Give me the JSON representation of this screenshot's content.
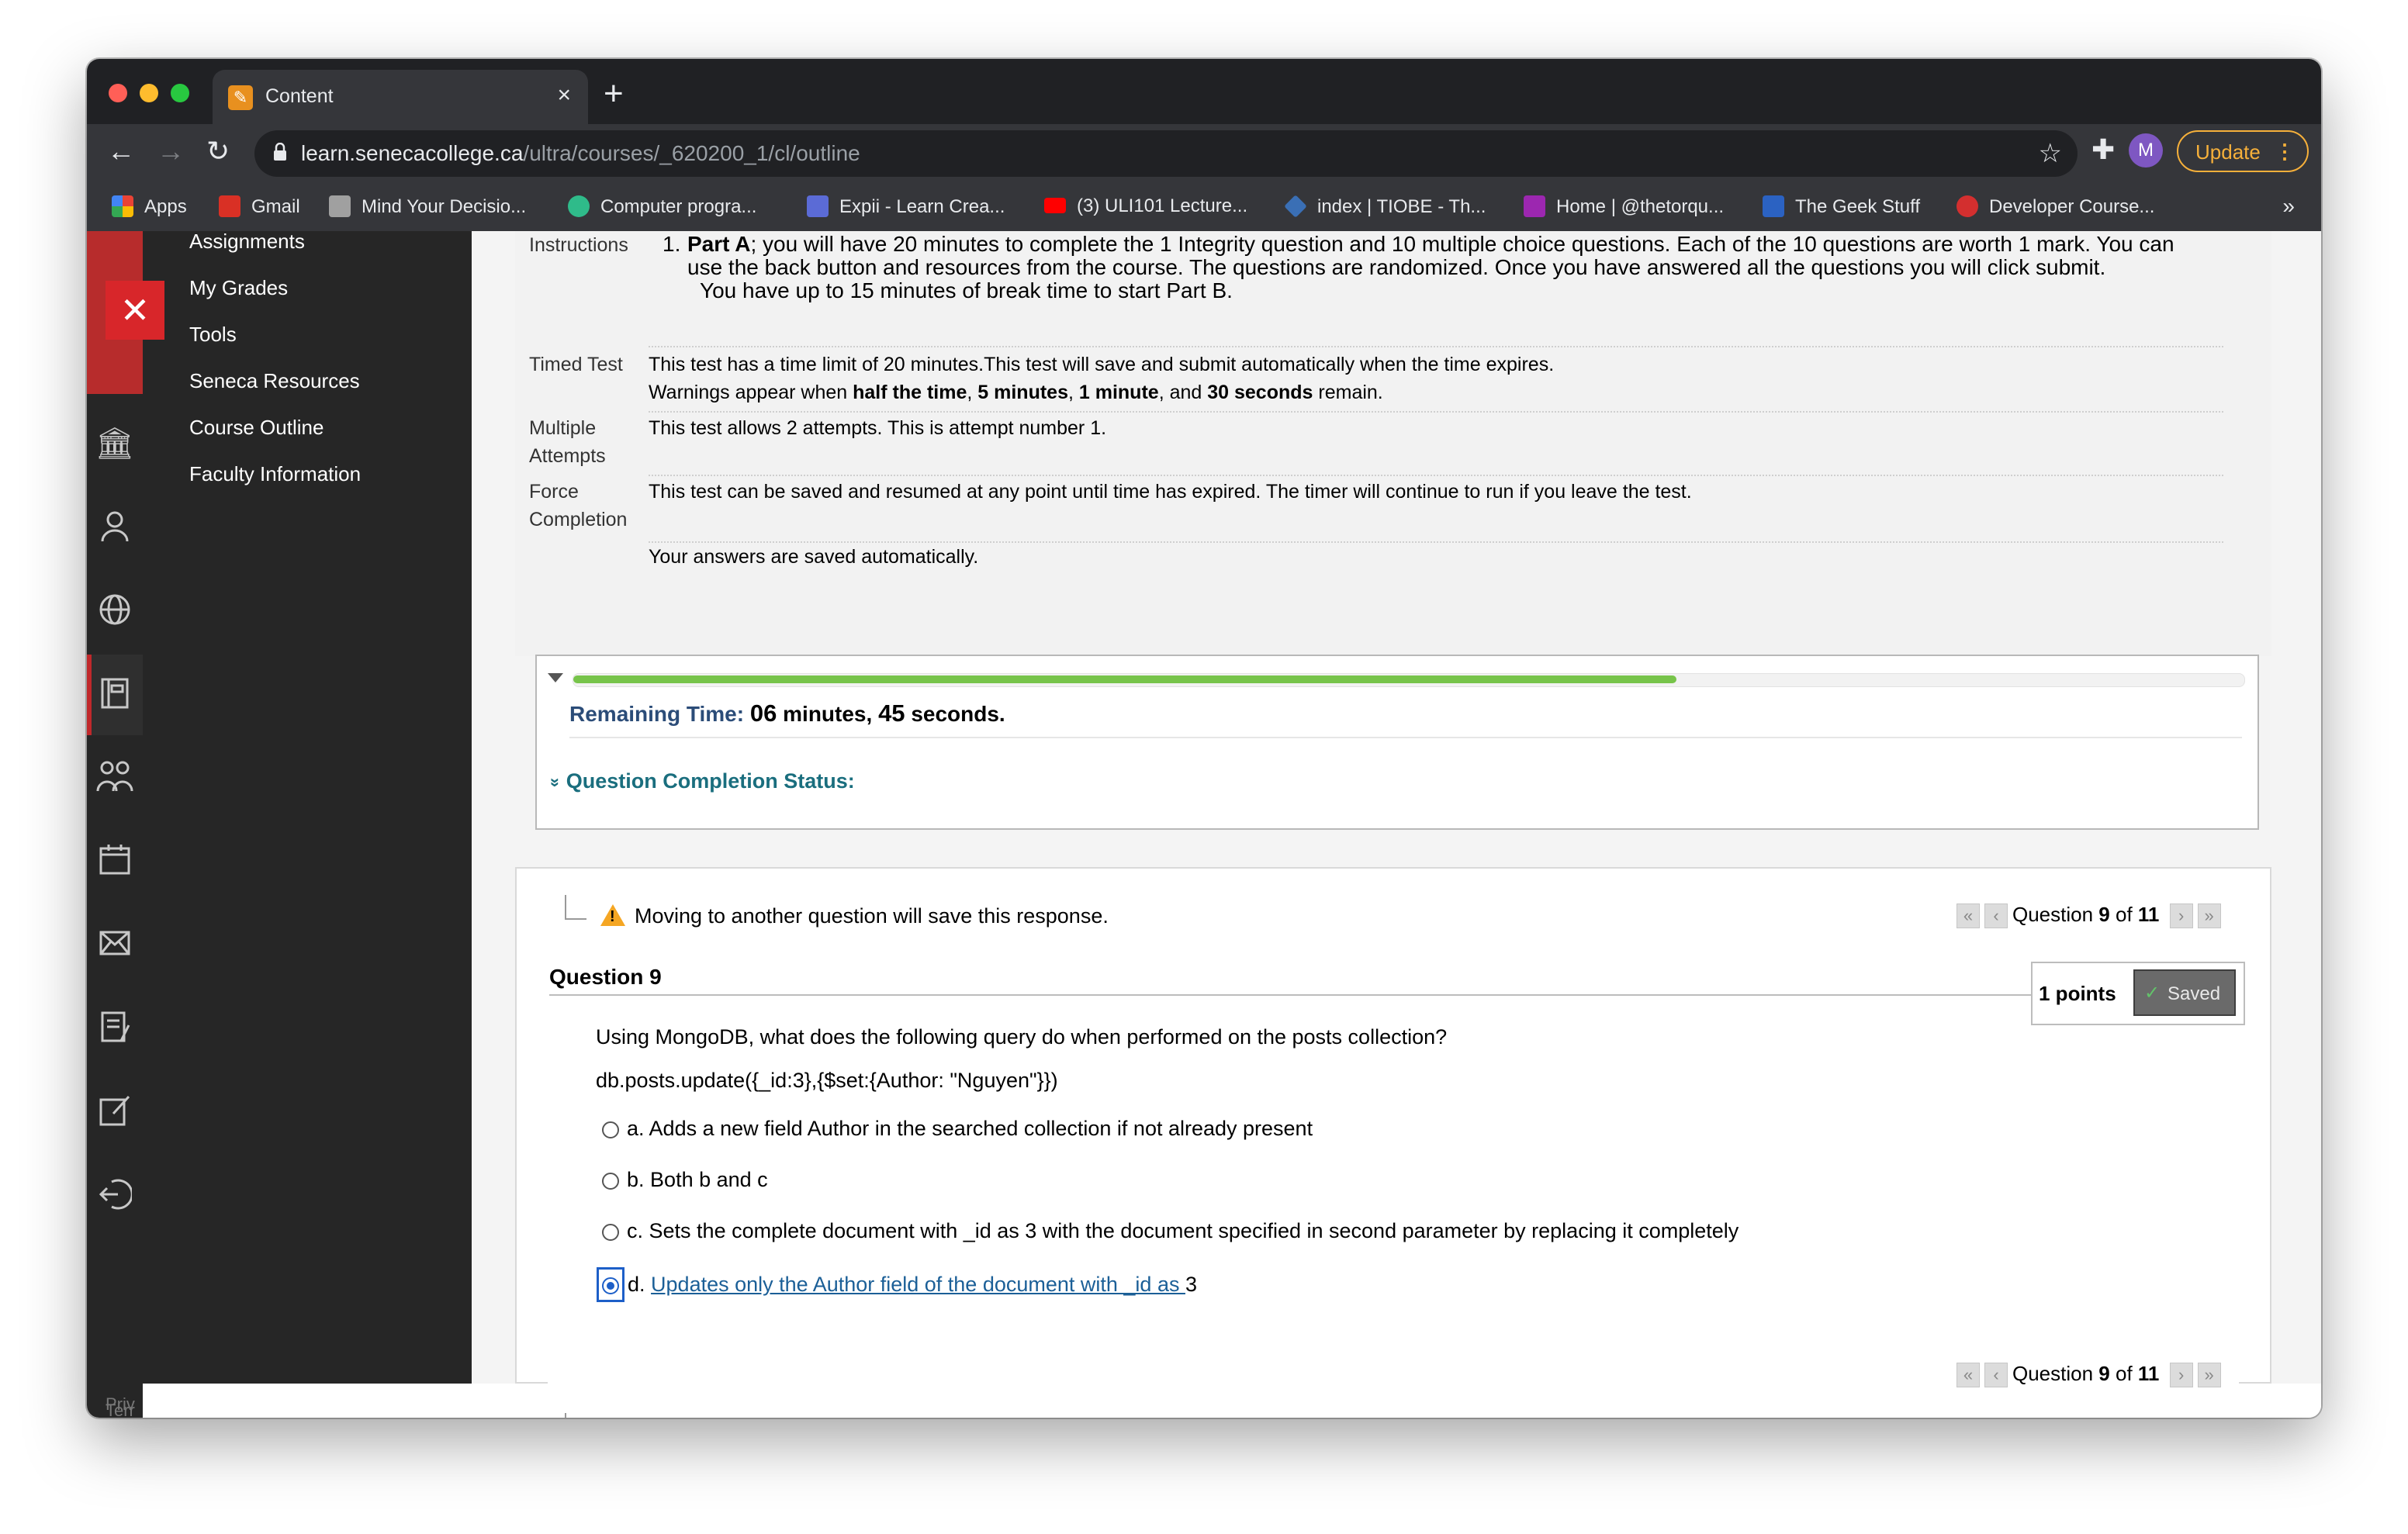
{
  "browser": {
    "tab_title": "Content",
    "tab_close": "×",
    "new_tab": "+",
    "url_host": "learn.senecacollege.ca",
    "url_path": "/ultra/courses/_620200_1/cl/outline",
    "profile_initial": "M",
    "update_label": "Update",
    "update_menu": "⋮",
    "bookmarks_more": "»",
    "bookmarks": [
      {
        "label": "Apps",
        "color": "#ea4335"
      },
      {
        "label": "Gmail",
        "color": "#d93025"
      },
      {
        "label": "Mind Your Decisio...",
        "color": "#a0a0a0"
      },
      {
        "label": "Computer progra...",
        "color": "#2fbb8a"
      },
      {
        "label": "Expii - Learn Crea...",
        "color": "#5b6bd6"
      },
      {
        "label": "(3) ULI101 Lecture...",
        "color": "#ff0000"
      },
      {
        "label": "index | TIOBE - Th...",
        "color": "#3a6fb5"
      },
      {
        "label": "Home | @thetorqu...",
        "color": "#9c27b0"
      },
      {
        "label": "The Geek Stuff",
        "color": "#2b62c2"
      },
      {
        "label": "Developer Course...",
        "color": "#d32f2f"
      }
    ]
  },
  "sidebar": {
    "close_glyph": "✕",
    "items": [
      "Assignments",
      "My Grades",
      "Tools",
      "Seneca Resources",
      "Course Outline",
      "Faculty Information"
    ],
    "footer_top": "Priv",
    "footer_bottom": "Terr"
  },
  "test_info": {
    "instructions_label": "Instructions",
    "instructions_num": "1.",
    "part_a": "Part A",
    "instructions_text": "; you will have 20 minutes to complete the 1 Integrity question and 10 multiple choice questions. Each of the 10 questions are worth 1 mark. You can use the back button and resources from the course.  The questions are randomized.  Once you have answered all the questions you will click submit.",
    "instructions_break": "You have up to 15 minutes of break time to start Part B.",
    "timed_label": "Timed Test",
    "timed_text": "This test has a time limit of 20 minutes.This test will save and submit automatically when the time expires.",
    "warn_prefix": "Warnings appear when ",
    "warn_1": "half the time",
    "warn_sep1": ", ",
    "warn_2": "5 minutes",
    "warn_sep2": ", ",
    "warn_3": "1 minute",
    "warn_sep3": ", and ",
    "warn_4": "30 seconds",
    "warn_suffix": " remain.",
    "multiple_label_1": "Multiple",
    "multiple_label_2": "Attempts",
    "multiple_text": "This test allows 2 attempts. This is attempt number 1.",
    "force_label_1": "Force",
    "force_label_2": "Completion",
    "force_text": "This test can be saved and resumed at any point until time has expired. The timer will continue to run if you leave the test.",
    "autosave_text": "Your answers are saved automatically."
  },
  "timer": {
    "progress_fraction": 0.66,
    "progress_color": "#77c44a",
    "label": "Remaining Time:",
    "minutes": "06",
    "minutes_word": " minutes, ",
    "seconds": "45",
    "seconds_word": " seconds.",
    "completion_status": "Question Completion Status:",
    "completion_glyph": "»"
  },
  "question": {
    "warning": "Moving to another question will save this response.",
    "pager_prefix": "Question ",
    "pager_current": "9",
    "pager_of": " of ",
    "pager_total": "11",
    "title": "Question 9",
    "points": "1 points",
    "saved_check": "✓",
    "saved_label": "Saved",
    "prompt": "Using MongoDB, what does the following query do when performed on the posts collection?",
    "code": "db.posts.update({_id:3},{$set:{Author: \"Nguyen\"}})",
    "options": [
      {
        "letter": "a.",
        "text": "Adds a new field Author in the searched collection if not already present"
      },
      {
        "letter": "b.",
        "text": "Both b and c"
      },
      {
        "letter": "c.",
        "text": "Sets the complete document with _id as 3 with the document specified in second parameter by replacing it completely"
      },
      {
        "letter": "d.",
        "text": "Updates only the Author field of the document with _id as ",
        "suffix": "3"
      }
    ],
    "selected": "d"
  }
}
